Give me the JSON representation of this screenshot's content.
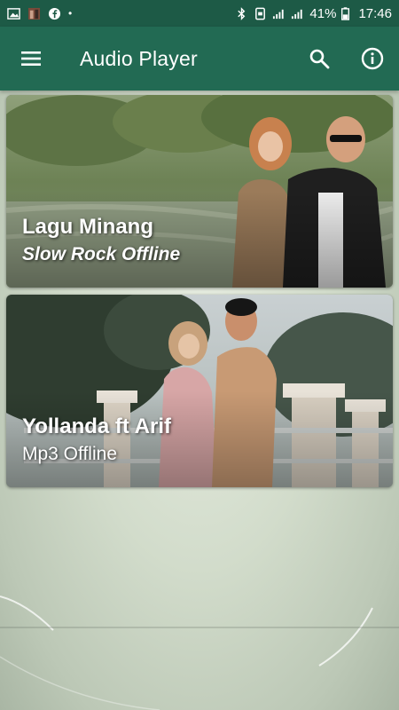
{
  "status_bar": {
    "battery": "41%",
    "time": "17:46"
  },
  "app_bar": {
    "title": "Audio Player",
    "icons": [
      "menu-icon",
      "search-icon",
      "info-icon"
    ]
  },
  "cards": [
    {
      "title": "Lagu Minang",
      "subtitle": "Slow Rock Offline"
    },
    {
      "title": "Yollanda ft Arif",
      "subtitle": "Mp3 Offline"
    }
  ],
  "colors": {
    "status_bar": "#1d5a46",
    "app_bar": "#226a53",
    "background": "#d2dccb"
  }
}
